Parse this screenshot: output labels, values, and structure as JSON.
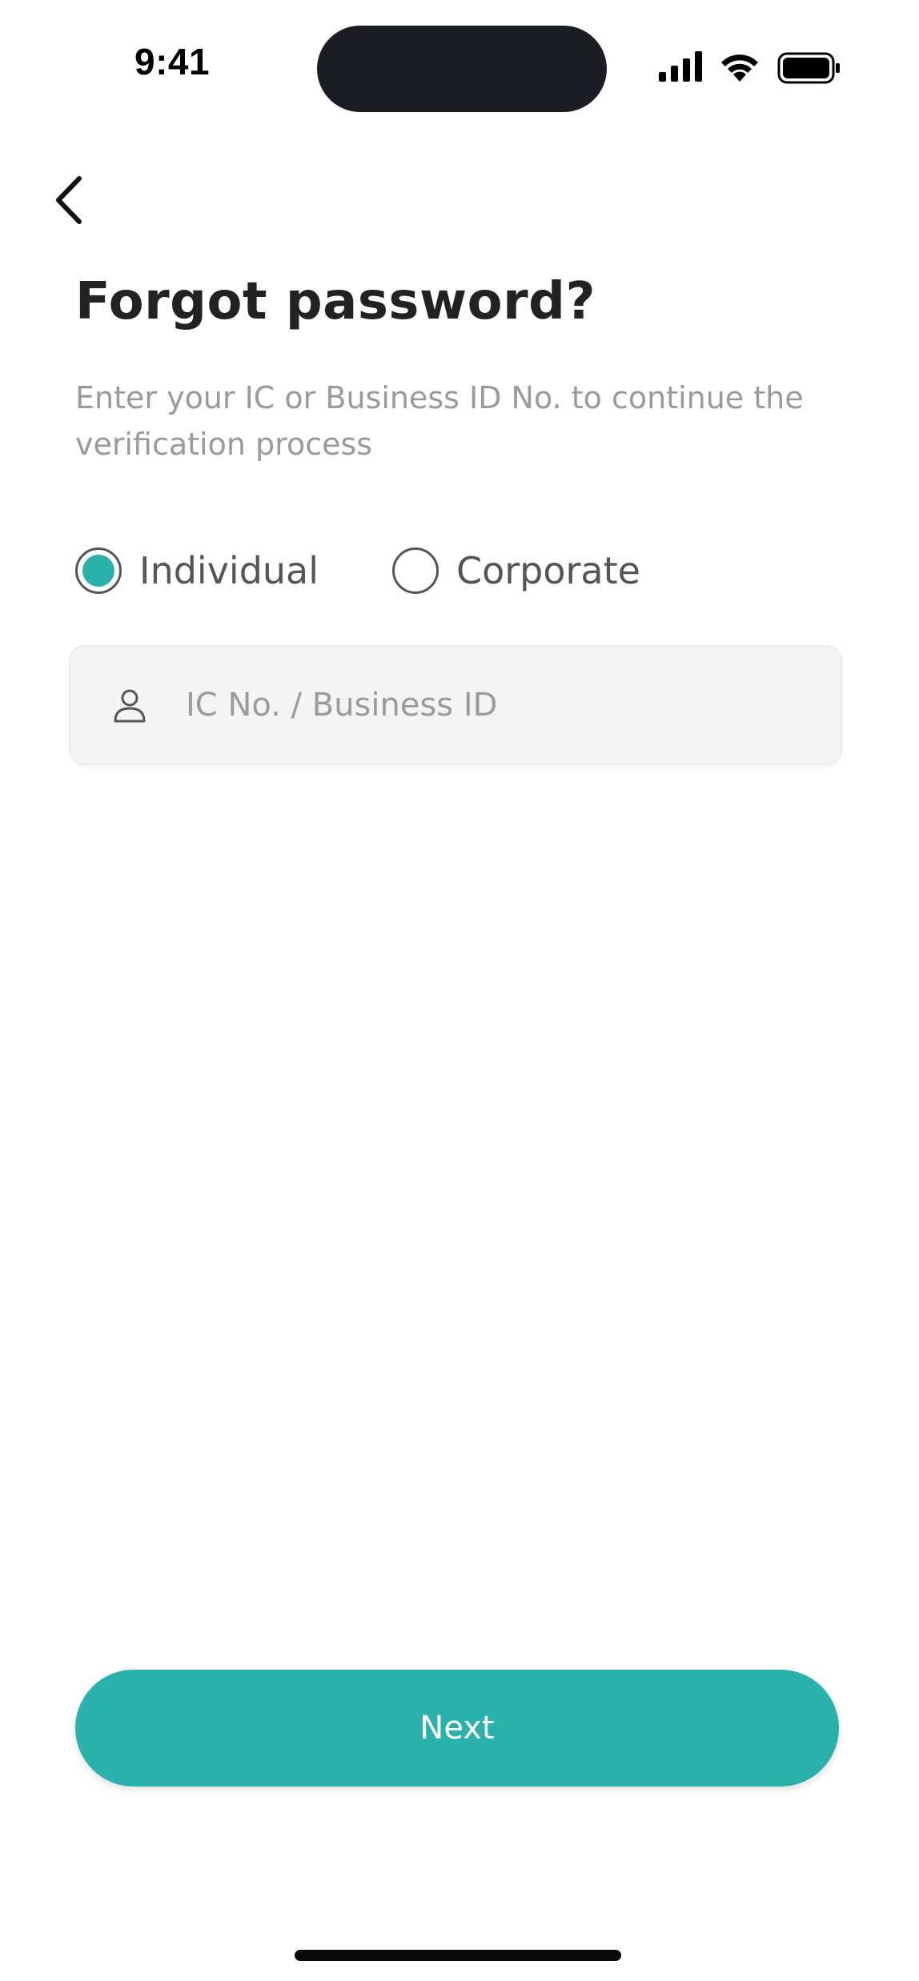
{
  "status_bar": {
    "time": "9:41",
    "icons": [
      "signal-icon",
      "wifi-icon",
      "battery-icon"
    ]
  },
  "header": {
    "back_icon": "chevron-left-icon",
    "title": "Forgot password?",
    "subtitle": "Enter your IC or Business ID No. to continue the verification process"
  },
  "account_type": {
    "selected": "Individual",
    "options": [
      {
        "label": "Individual",
        "selected": true
      },
      {
        "label": "Corporate",
        "selected": false
      }
    ]
  },
  "id_field": {
    "icon": "user-icon",
    "value": "",
    "placeholder": "IC No. / Business ID"
  },
  "footer": {
    "next_label": "Next"
  },
  "colors": {
    "accent": "#2bb1ab",
    "title": "#222222",
    "subtitle": "#9a9a9a",
    "input_bg": "#f4f4f4"
  }
}
